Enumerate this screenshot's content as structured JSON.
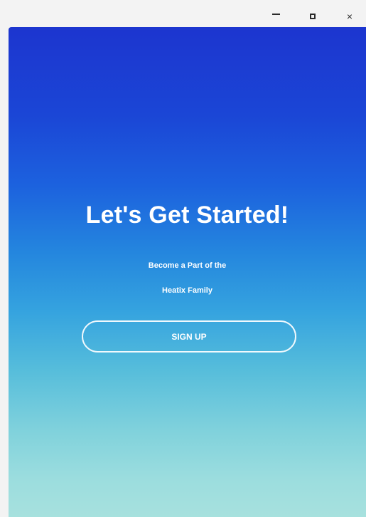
{
  "window": {
    "controls": {
      "minimize_icon": "minimize-icon",
      "maximize_icon": "maximize-icon",
      "close_icon": "close-icon",
      "close_glyph": "×"
    }
  },
  "hero": {
    "title": "Let's Get Started!",
    "subtitle_line1": "Become a Part of the",
    "subtitle_line2": "Heatix Family",
    "signup_label": "SIGN UP"
  },
  "colors": {
    "gradient_top": "#1c35cf",
    "gradient_bottom": "#a7e1de",
    "text": "#ffffff"
  }
}
